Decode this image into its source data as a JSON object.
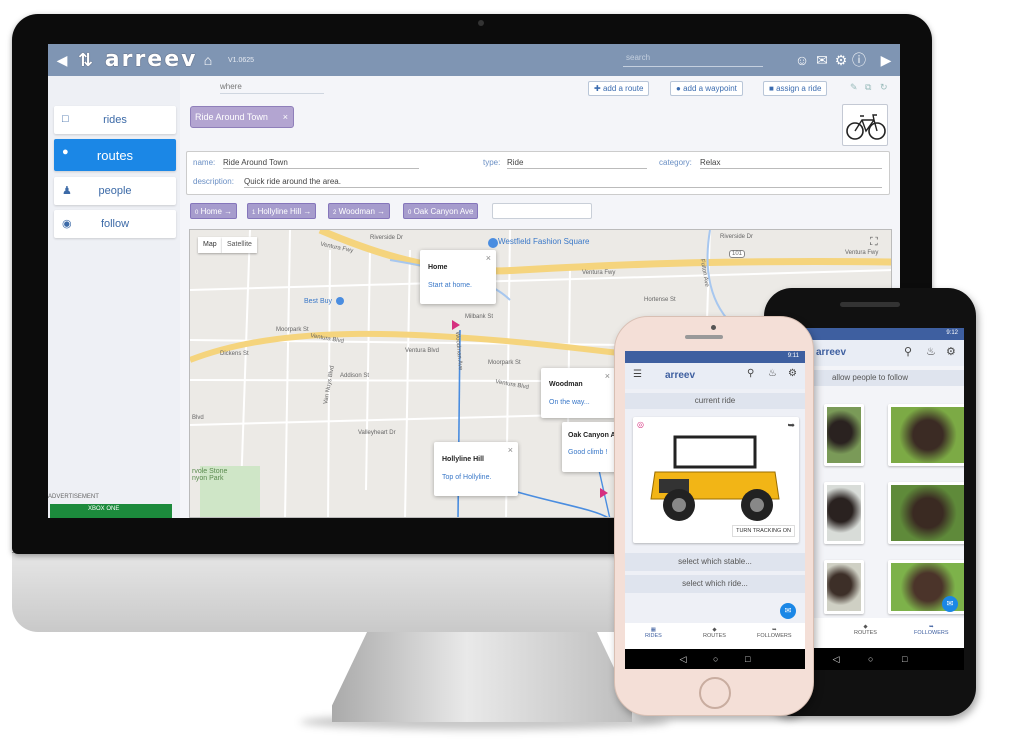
{
  "desktop": {
    "app_name": "arreev",
    "version": "V1.0625",
    "search_placeholder": "search",
    "sidebar": {
      "items": [
        {
          "label": "rides",
          "icon": "bus-icon"
        },
        {
          "label": "routes",
          "icon": "map-pin-icon"
        },
        {
          "label": "people",
          "icon": "person-icon"
        },
        {
          "label": "follow",
          "icon": "globe-icon"
        }
      ],
      "ad_label": "ADVERTISEMENT",
      "ad_text": "XBOX ONE"
    },
    "toolbar": {
      "where_placeholder": "where",
      "add_route": "add a route",
      "add_waypoint": "add a waypoint",
      "assign_ride": "assign a ride"
    },
    "route_chip": "Ride Around Town",
    "details": {
      "name_label": "name:",
      "name_value": "Ride Around Town",
      "type_label": "type:",
      "type_value": "Ride",
      "category_label": "category:",
      "category_value": "Relax",
      "description_label": "description:",
      "description_value": "Quick ride around the area."
    },
    "waypoints": [
      {
        "label": "Home",
        "marker": "0"
      },
      {
        "label": "Hollyline Hill",
        "marker": "1"
      },
      {
        "label": "Woodman",
        "marker": "2"
      },
      {
        "label": "Oak Canyon Ave",
        "marker": "0"
      }
    ],
    "map": {
      "map_btn": "Map",
      "satellite_btn": "Satellite",
      "poi_mall": "Westfield Fashion Square",
      "poi_store": "Best Buy",
      "poi_park": "rvole Stone\nnyon Park",
      "streets": {
        "fwy1": "Ventura Fwy",
        "fwy2": "Ventura Fwy",
        "fwy3": "Ventura Fwy",
        "riverside1": "Riverside Dr",
        "riverside2": "Riverside Dr",
        "blvd1": "Ventura Blvd",
        "blvd2": "Ventura Blvd",
        "blvd3": "Ventura Blvd",
        "moorpark1": "Moorpark St",
        "moorpark2": "Moorpark St",
        "milbank": "Milbank St",
        "dickens": "Dickens St",
        "hortense": "Hortense St",
        "addison": "Addison St",
        "valleyheart": "Valleyheart Dr",
        "blvd_short": "Blvd",
        "fulton": "Fulton Ave",
        "woodman": "Woodman Ave",
        "vannuys": "Van Nuys Blvd",
        "hwy": "101"
      },
      "popups": [
        {
          "title": "Home",
          "desc": "Start at home."
        },
        {
          "title": "Woodman",
          "desc": "On the way..."
        },
        {
          "title": "Oak Canyon A",
          "desc": "Good climb !"
        },
        {
          "title": "Hollyline Hill",
          "desc": "Top of Hollyline."
        }
      ]
    }
  },
  "iphone": {
    "time": "9:11",
    "app_name": "arreev",
    "current_ride": "current ride",
    "tracking_btn": "TURN TRACKING ON",
    "select_stable": "select which stable...",
    "select_ride": "select which ride...",
    "nav": [
      "RIDES",
      "ROUTES",
      "FOLLOWERS"
    ]
  },
  "android": {
    "time": "9:12",
    "app_name": "arreev",
    "allow_follow": "allow people to follow",
    "nav": [
      "ROUTES",
      "FOLLOWERS"
    ]
  }
}
